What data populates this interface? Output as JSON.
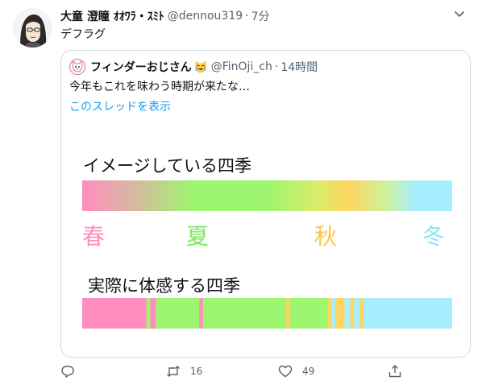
{
  "tweet": {
    "author_name": "大童 澄瞳 ｵｵﾜﾗ・ｽﾐﾄ",
    "handle": "@dennou319",
    "separator": "·",
    "time": "7分",
    "text": "デフラグ"
  },
  "quote": {
    "author_name": "フィンダーおじさん",
    "handle": "@FinOji_ch",
    "separator": "·",
    "time": "14時間",
    "text": "今年もこれを味わう時期が来たな…",
    "thread_link": "このスレッドを表示"
  },
  "image": {
    "title_imagined": "イメージしている四季",
    "title_real": "実際に体感する四季",
    "seasons": {
      "spring": "春",
      "summer": "夏",
      "autumn": "秋",
      "winter": "冬"
    },
    "colors": {
      "spring": "#ff8ebf",
      "summer": "#9ef570",
      "autumn": "#ffd561",
      "winter": "#a7efff"
    },
    "real_segments": [
      {
        "season": "spring",
        "fraction": 0.17
      },
      {
        "season": "summer",
        "fraction": 0.01
      },
      {
        "season": "spring",
        "fraction": 0.015
      },
      {
        "season": "summer",
        "fraction": 0.115
      },
      {
        "season": "spring",
        "fraction": 0.01
      },
      {
        "season": "summer",
        "fraction": 0.22
      },
      {
        "season": "autumn",
        "fraction": 0.01
      },
      {
        "season": "summer",
        "fraction": 0.1
      },
      {
        "season": "autumn",
        "fraction": 0.01
      },
      {
        "season": "winter",
        "fraction": 0.01
      },
      {
        "season": "autumn",
        "fraction": 0.025
      },
      {
        "season": "winter",
        "fraction": 0.015
      },
      {
        "season": "autumn",
        "fraction": 0.01
      },
      {
        "season": "winter",
        "fraction": 0.015
      },
      {
        "season": "autumn",
        "fraction": 0.01
      },
      {
        "season": "winter",
        "fraction": 0.235
      }
    ]
  },
  "actions": {
    "reply_count": "",
    "retweet_count": "16",
    "like_count": "49"
  },
  "icons": {
    "caret": "chevron-down-icon",
    "reply": "reply-icon",
    "retweet": "retweet-icon",
    "like": "heart-icon",
    "share": "share-icon"
  },
  "theme": {
    "link": "#1d9bf0",
    "muted": "#536471",
    "border": "#cfd9de"
  }
}
